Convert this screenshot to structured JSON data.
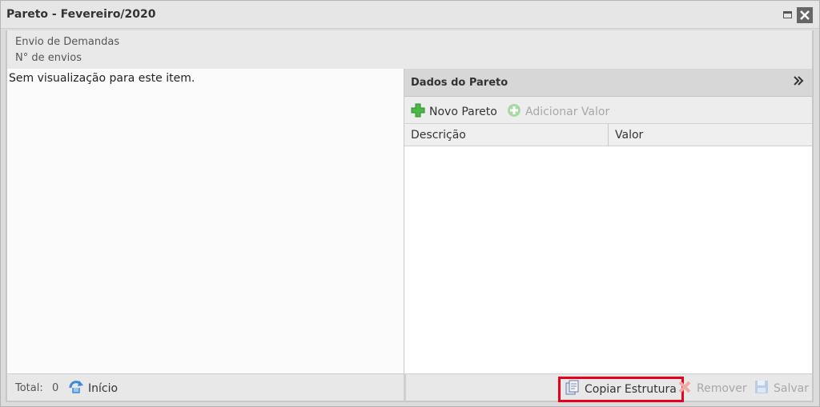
{
  "window": {
    "title": "Pareto - Fevereiro/2020",
    "maximize_icon": "maximize-icon",
    "close_icon": "close-icon"
  },
  "header": {
    "line1": "Envio de Demandas",
    "line2": "N° de envios"
  },
  "left_panel": {
    "empty_message": "Sem visualização para este item."
  },
  "right_panel": {
    "title": "Dados do Pareto",
    "collapse_icon": "double-chevron-right-icon",
    "toolbar": {
      "novo_label": "Novo Pareto",
      "adicionar_label": "Adicionar Valor"
    },
    "columns": [
      "Descrição",
      "Valor"
    ]
  },
  "footer": {
    "total_label": "Total:",
    "total_value": "0",
    "inicio_label": "Início",
    "copiar_label": "Copiar Estrutura",
    "remover_label": "Remover",
    "salvar_label": "Salvar"
  },
  "colors": {
    "highlight": "#e8001c",
    "plus_green": "#4cb848",
    "disabled_text": "#a8a8a8"
  }
}
